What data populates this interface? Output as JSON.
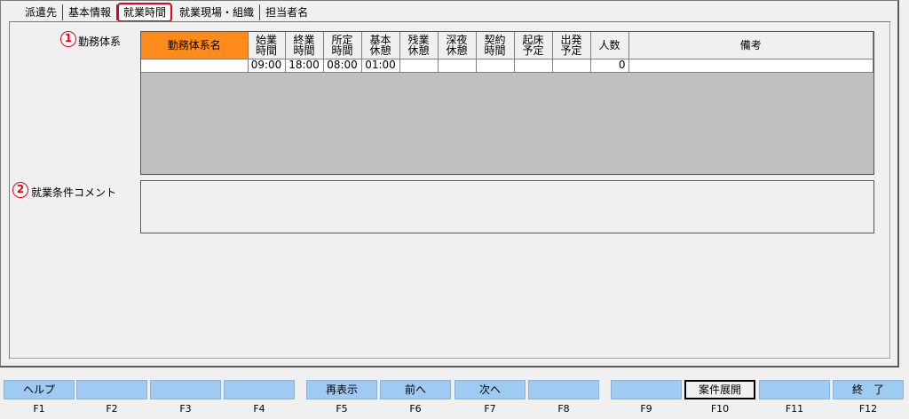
{
  "tabs": [
    {
      "label": "派遣先",
      "active": false
    },
    {
      "label": "基本情報",
      "active": false
    },
    {
      "label": "就業時間",
      "active": true
    },
    {
      "label": "就業現場・組織",
      "active": false
    },
    {
      "label": "担当者名",
      "active": false
    }
  ],
  "badges": {
    "one": "1",
    "two": "2"
  },
  "labels": {
    "work_system": "勤務体系",
    "comment": "就業条件コメント"
  },
  "grid": {
    "headers": [
      [
        "勤務体系名"
      ],
      [
        "始業",
        "時間"
      ],
      [
        "終業",
        "時間"
      ],
      [
        "所定",
        "時間"
      ],
      [
        "基本",
        "休憩"
      ],
      [
        "残業",
        "休憩"
      ],
      [
        "深夜",
        "休憩"
      ],
      [
        "契約",
        "時間"
      ],
      [
        "起床",
        "予定"
      ],
      [
        "出発",
        "予定"
      ],
      [
        "人数"
      ],
      [
        "備考"
      ]
    ],
    "row": [
      "",
      "09:00",
      "18:00",
      "08:00",
      "01:00",
      "",
      "",
      "",
      "",
      "",
      "0",
      ""
    ]
  },
  "comment_value": "",
  "fkeys": [
    {
      "label": "ヘルプ",
      "key": "F1"
    },
    {
      "label": "",
      "key": "F2"
    },
    {
      "label": "",
      "key": "F3"
    },
    {
      "label": "",
      "key": "F4"
    },
    {
      "label": "再表示",
      "key": "F5"
    },
    {
      "label": "前へ",
      "key": "F6"
    },
    {
      "label": "次へ",
      "key": "F7"
    },
    {
      "label": "",
      "key": "F8"
    },
    {
      "label": "",
      "key": "F9"
    },
    {
      "label": "案件展開",
      "key": "F10"
    },
    {
      "label": "",
      "key": "F11"
    },
    {
      "label": "終　了",
      "key": "F12"
    }
  ],
  "colors": {
    "accent_red": "#e60012",
    "header_orange": "#ff8c1a",
    "fkey_blue": "#9fcbf3",
    "grid_gray": "#c0c0c0"
  }
}
